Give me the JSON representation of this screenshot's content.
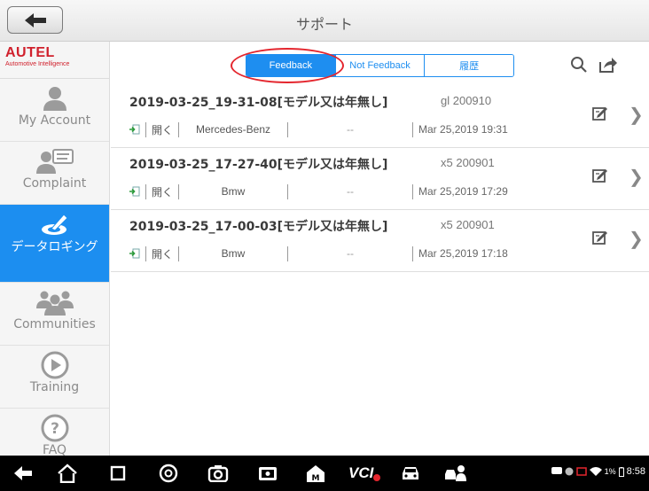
{
  "header": {
    "title": "サポート",
    "back_icon": "back-arrow-icon"
  },
  "sidebar": {
    "logo": {
      "brand": "AUTEL",
      "tagline": "Automotive Intelligence",
      "color": "#d0202c"
    },
    "items": [
      {
        "label": "My Account",
        "icon": "person-icon"
      },
      {
        "label": "Complaint",
        "icon": "complaint-chat-icon"
      },
      {
        "label": "データロギング",
        "icon": "data-logging-icon",
        "active": true
      },
      {
        "label": "Communities",
        "icon": "group-icon"
      },
      {
        "label": "Training",
        "icon": "play-icon"
      },
      {
        "label": "FAQ",
        "icon": "question-icon"
      }
    ]
  },
  "toolbar": {
    "tabs": [
      {
        "label": "Feedback",
        "active": true
      },
      {
        "label": "Not Feedback"
      },
      {
        "label": "履歴"
      }
    ],
    "accent_color": "#1e8ef0",
    "highlight_color": "#e4262e"
  },
  "rows": [
    {
      "title": "2019-03-25_19-31-08[モデル又は年無し]",
      "model": "gl 200910",
      "open": "開く",
      "make": "Mercedes-Benz",
      "dash": "--",
      "date": "Mar 25,2019 19:31"
    },
    {
      "title": "2019-03-25_17-27-40[モデル又は年無し]",
      "model": "x5 200901",
      "open": "開く",
      "make": "Bmw",
      "dash": "--",
      "date": "Mar 25,2019 17:29"
    },
    {
      "title": "2019-03-25_17-00-03[モデル又は年無し]",
      "model": "x5 200901",
      "open": "開く",
      "make": "Bmw",
      "dash": "--",
      "date": "Mar 25,2019 17:18"
    }
  ],
  "navbar": {
    "vci_label": "VCI",
    "status": {
      "battery": "1%",
      "time": "8:58"
    }
  }
}
